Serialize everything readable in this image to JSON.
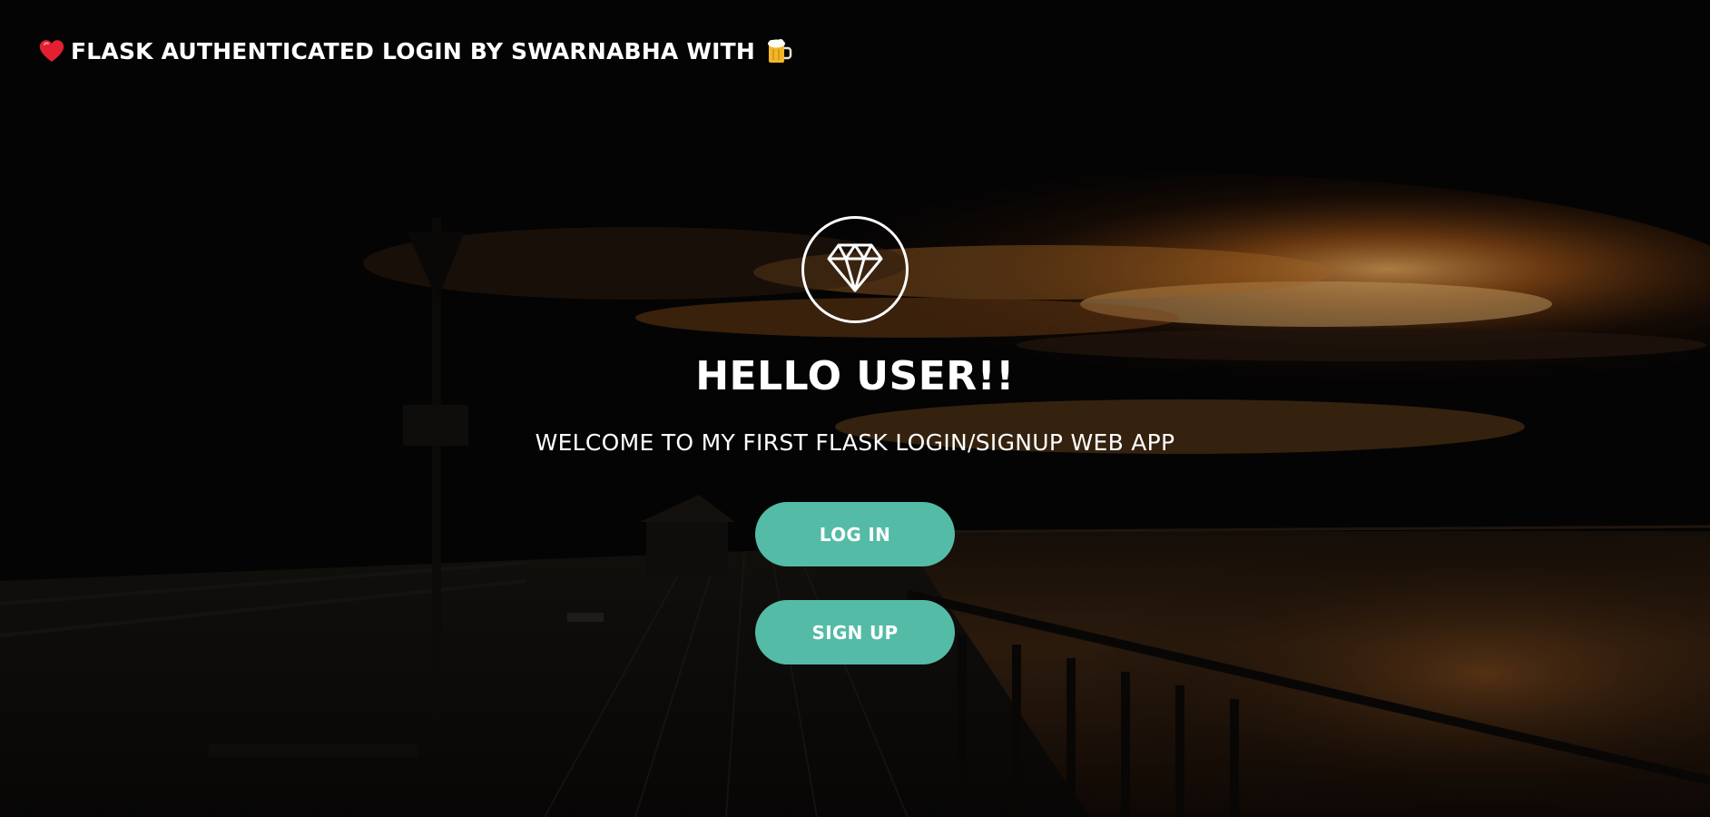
{
  "navbar": {
    "heart_icon": "red-heart-icon",
    "title": "FLASK AUTHENTICATED LOGIN BY SWARNABHA WITH",
    "beer_icon": "beer-mug-icon"
  },
  "hero": {
    "logo_icon": "diamond-icon",
    "title": "HELLO USER!!",
    "subtitle": "WELCOME TO MY FIRST FLASK LOGIN/SIGNUP WEB APP"
  },
  "buttons": {
    "login_label": "LOG IN",
    "signup_label": "SIGN UP"
  },
  "colors": {
    "button_bg": "#54bba6",
    "text": "#ffffff",
    "sky_glow": "#c8641e"
  }
}
